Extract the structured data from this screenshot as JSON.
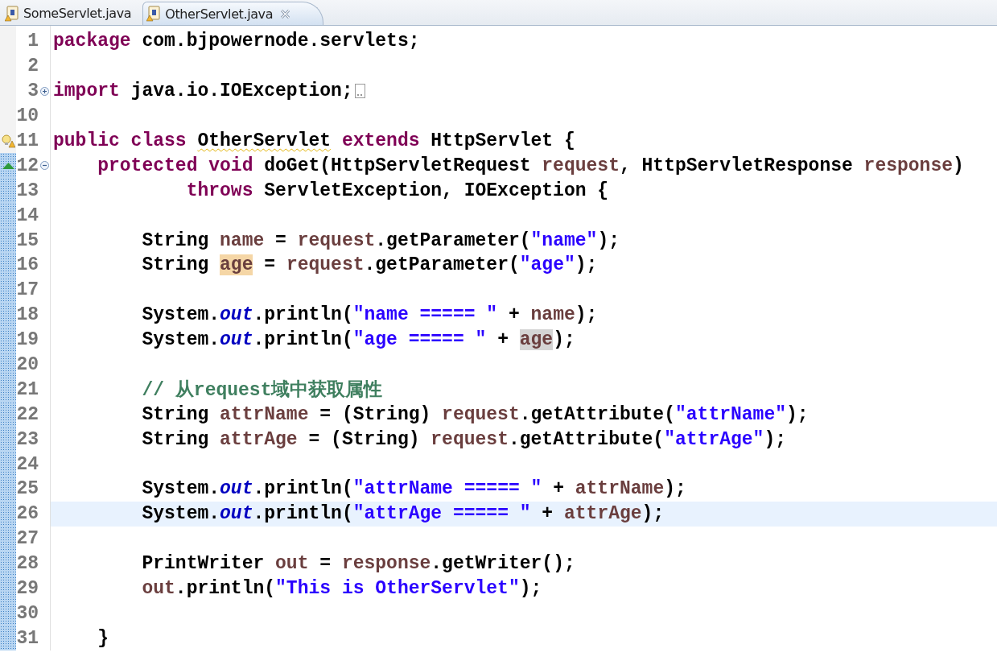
{
  "tabs": [
    {
      "label": "SomeServlet.java",
      "selected": false,
      "closable": false
    },
    {
      "label": "OtherServlet.java",
      "selected": true,
      "closable": true
    }
  ],
  "lines": [
    {
      "number": "1",
      "current": false,
      "changed": false,
      "tokens": [
        {
          "kind": "kw",
          "text": "package"
        },
        {
          "kind": "plain",
          "text": " com.bjpowernode.servlets;"
        }
      ]
    },
    {
      "number": "2",
      "current": false,
      "changed": false
    },
    {
      "number": "3",
      "current": false,
      "changed": false,
      "foldable": true,
      "folded": true,
      "tokens": [
        {
          "kind": "kw",
          "text": "import"
        },
        {
          "kind": "plain",
          "text": " java.io.IOException;"
        }
      ]
    },
    {
      "number": "10",
      "current": false,
      "changed": false
    },
    {
      "number": "11",
      "current": false,
      "changed": false,
      "warning": true,
      "tokens": [
        {
          "kind": "kw",
          "text": "public class "
        },
        {
          "kind": "plain",
          "text": "OtherServlet",
          "warning": true
        },
        {
          "kind": "kw",
          "text": " extends"
        },
        {
          "kind": "plain",
          "text": " HttpServlet {"
        }
      ]
    },
    {
      "number": "12",
      "current": false,
      "changed": true,
      "override": true,
      "foldable": true,
      "folded": false,
      "tokens": [
        {
          "kind": "kw",
          "text": "    protected void"
        },
        {
          "kind": "plain",
          "text": " doGet(HttpServletRequest "
        },
        {
          "kind": "var",
          "text": "request"
        },
        {
          "kind": "plain",
          "text": ", HttpServletResponse "
        },
        {
          "kind": "var",
          "text": "response"
        },
        {
          "kind": "plain",
          "text": ")"
        }
      ]
    },
    {
      "number": "13",
      "current": false,
      "changed": true,
      "tokens": [
        {
          "kind": "kw",
          "text": "            throws"
        },
        {
          "kind": "plain",
          "text": " ServletException, IOException {"
        }
      ]
    },
    {
      "number": "14",
      "current": false,
      "changed": true
    },
    {
      "number": "15",
      "current": false,
      "changed": true,
      "tokens": [
        {
          "kind": "plain",
          "text": "        String "
        },
        {
          "kind": "var",
          "text": "name"
        },
        {
          "kind": "plain",
          "text": " = "
        },
        {
          "kind": "var",
          "text": "request"
        },
        {
          "kind": "plain",
          "text": ".getParameter("
        },
        {
          "kind": "str",
          "text": "\"name\""
        },
        {
          "kind": "plain",
          "text": ");"
        }
      ]
    },
    {
      "number": "16",
      "current": false,
      "changed": true,
      "tokens": [
        {
          "kind": "plain",
          "text": "        String "
        },
        {
          "kind": "var",
          "text": "age",
          "highlighted": true,
          "write_access": true
        },
        {
          "kind": "plain",
          "text": " = "
        },
        {
          "kind": "var",
          "text": "request"
        },
        {
          "kind": "plain",
          "text": ".getParameter("
        },
        {
          "kind": "str",
          "text": "\"age\""
        },
        {
          "kind": "plain",
          "text": ");"
        }
      ]
    },
    {
      "number": "17",
      "current": false,
      "changed": true
    },
    {
      "number": "18",
      "current": false,
      "changed": true,
      "tokens": [
        {
          "kind": "plain",
          "text": "        System."
        },
        {
          "kind": "static",
          "text": "out"
        },
        {
          "kind": "plain",
          "text": ".println("
        },
        {
          "kind": "str",
          "text": "\"name ===== \""
        },
        {
          "kind": "plain",
          "text": " + "
        },
        {
          "kind": "var",
          "text": "name"
        },
        {
          "kind": "plain",
          "text": ");"
        }
      ]
    },
    {
      "number": "19",
      "current": false,
      "changed": true,
      "tokens": [
        {
          "kind": "plain",
          "text": "        System."
        },
        {
          "kind": "static",
          "text": "out"
        },
        {
          "kind": "plain",
          "text": ".println("
        },
        {
          "kind": "str",
          "text": "\"age ===== \""
        },
        {
          "kind": "plain",
          "text": " + "
        },
        {
          "kind": "var",
          "text": "age",
          "highlighted": true,
          "write_access": false
        },
        {
          "kind": "plain",
          "text": ");"
        }
      ]
    },
    {
      "number": "20",
      "current": false,
      "changed": true
    },
    {
      "number": "21",
      "current": false,
      "changed": true,
      "tokens": [
        {
          "kind": "comment",
          "text": "        // 从request域中获取属性"
        }
      ]
    },
    {
      "number": "22",
      "current": false,
      "changed": true,
      "tokens": [
        {
          "kind": "plain",
          "text": "        String "
        },
        {
          "kind": "var",
          "text": "attrName"
        },
        {
          "kind": "plain",
          "text": " = (String) "
        },
        {
          "kind": "var",
          "text": "request"
        },
        {
          "kind": "plain",
          "text": ".getAttribute("
        },
        {
          "kind": "str",
          "text": "\"attrName\""
        },
        {
          "kind": "plain",
          "text": ");"
        }
      ]
    },
    {
      "number": "23",
      "current": false,
      "changed": true,
      "tokens": [
        {
          "kind": "plain",
          "text": "        String "
        },
        {
          "kind": "var",
          "text": "attrAge"
        },
        {
          "kind": "plain",
          "text": " = (String) "
        },
        {
          "kind": "var",
          "text": "request"
        },
        {
          "kind": "plain",
          "text": ".getAttribute("
        },
        {
          "kind": "str",
          "text": "\"attrAge\""
        },
        {
          "kind": "plain",
          "text": ");"
        }
      ]
    },
    {
      "number": "24",
      "current": false,
      "changed": true
    },
    {
      "number": "25",
      "current": false,
      "changed": true,
      "tokens": [
        {
          "kind": "plain",
          "text": "        System."
        },
        {
          "kind": "static",
          "text": "out"
        },
        {
          "kind": "plain",
          "text": ".println("
        },
        {
          "kind": "str",
          "text": "\"attrName ===== \""
        },
        {
          "kind": "plain",
          "text": " + "
        },
        {
          "kind": "var",
          "text": "attrName"
        },
        {
          "kind": "plain",
          "text": ");"
        }
      ]
    },
    {
      "number": "26",
      "current": true,
      "changed": true,
      "tokens": [
        {
          "kind": "plain",
          "text": "        System."
        },
        {
          "kind": "static",
          "text": "out"
        },
        {
          "kind": "plain",
          "text": ".println("
        },
        {
          "kind": "str",
          "text": "\"attrAge ===== \""
        },
        {
          "kind": "plain",
          "text": " + "
        },
        {
          "kind": "var",
          "text": "attrAge"
        },
        {
          "kind": "plain",
          "text": ");"
        }
      ]
    },
    {
      "number": "27",
      "current": false,
      "changed": true
    },
    {
      "number": "28",
      "current": false,
      "changed": true,
      "tokens": [
        {
          "kind": "plain",
          "text": "        PrintWriter "
        },
        {
          "kind": "var",
          "text": "out"
        },
        {
          "kind": "plain",
          "text": " = "
        },
        {
          "kind": "var",
          "text": "response"
        },
        {
          "kind": "plain",
          "text": ".getWriter();"
        }
      ]
    },
    {
      "number": "29",
      "current": false,
      "changed": true,
      "tokens": [
        {
          "kind": "var",
          "text": "        out"
        },
        {
          "kind": "plain",
          "text": ".println("
        },
        {
          "kind": "str",
          "text": "\"This is OtherServlet\""
        },
        {
          "kind": "plain",
          "text": ");"
        }
      ]
    },
    {
      "number": "30",
      "current": false,
      "changed": true
    },
    {
      "number": "31",
      "current": false,
      "changed": true,
      "tokens": [
        {
          "kind": "plain",
          "text": "    }"
        }
      ]
    }
  ]
}
